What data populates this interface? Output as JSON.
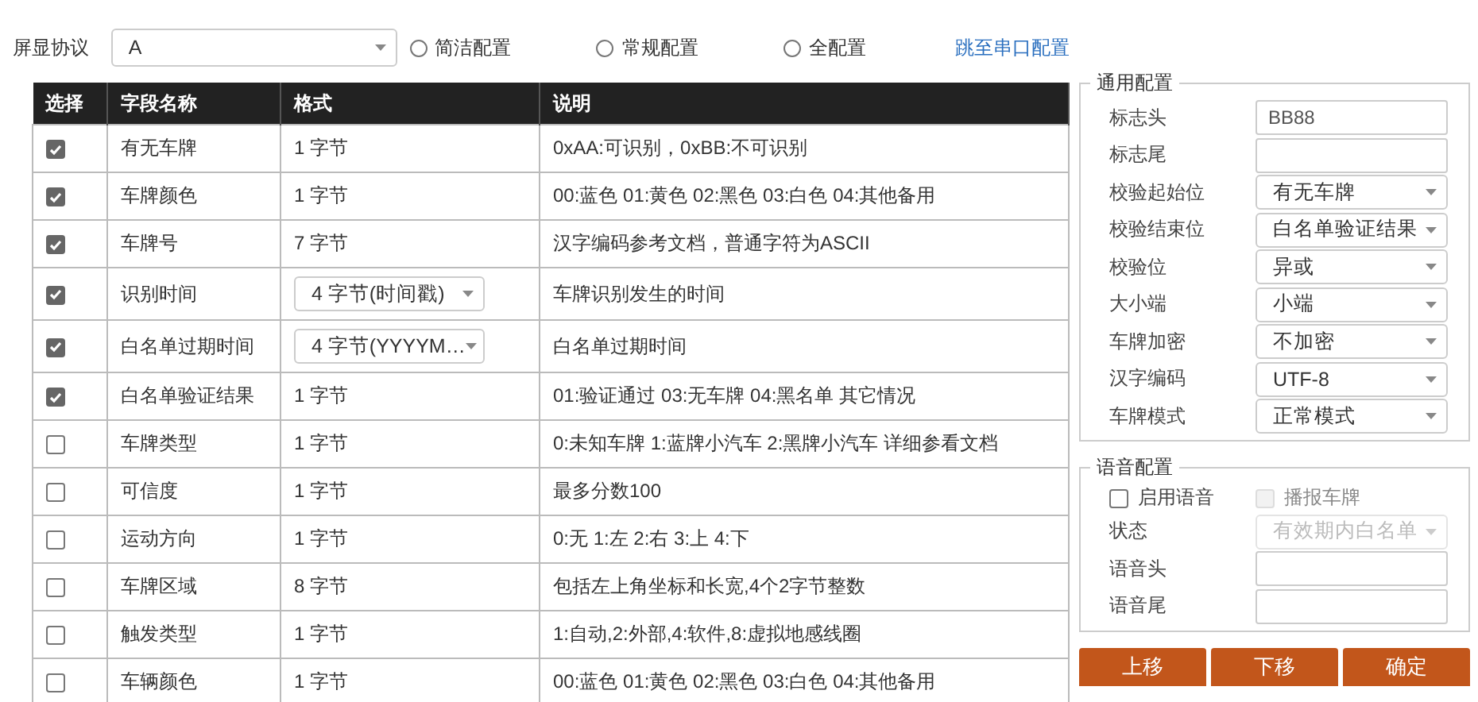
{
  "toolbar": {
    "protocol_label": "屏显协议",
    "protocol_value": "A",
    "radios": [
      {
        "label": "简洁配置",
        "selected": false
      },
      {
        "label": "常规配置",
        "selected": false
      },
      {
        "label": "全配置",
        "selected": false
      }
    ],
    "link": "跳至串口配置"
  },
  "table": {
    "columns": [
      "选择",
      "字段名称",
      "格式",
      "说明"
    ],
    "rows": [
      {
        "checked": true,
        "name": "有无车牌",
        "format": {
          "kind": "text",
          "value": "1 字节"
        },
        "description": "0xAA:可识别，0xBB:不可识别"
      },
      {
        "checked": true,
        "name": "车牌颜色",
        "format": {
          "kind": "text",
          "value": "1 字节"
        },
        "description": "00:蓝色 01:黄色 02:黑色 03:白色 04:其他备用"
      },
      {
        "checked": true,
        "name": "车牌号",
        "format": {
          "kind": "text",
          "value": "7 字节"
        },
        "description": "汉字编码参考文档，普通字符为ASCII"
      },
      {
        "checked": true,
        "name": "识别时间",
        "format": {
          "kind": "select",
          "value": "4 字节(时间戳)"
        },
        "description": "车牌识别发生的时间"
      },
      {
        "checked": true,
        "name": "白名单过期时间",
        "format": {
          "kind": "select",
          "value": "4 字节(YYYYM…"
        },
        "description": "白名单过期时间"
      },
      {
        "checked": true,
        "name": "白名单验证结果",
        "format": {
          "kind": "text",
          "value": "1 字节"
        },
        "description": "01:验证通过 03:无车牌 04:黑名单 其它情况"
      },
      {
        "checked": false,
        "name": "车牌类型",
        "format": {
          "kind": "text",
          "value": "1 字节"
        },
        "description": "0:未知车牌 1:蓝牌小汽车 2:黑牌小汽车 详细参看文档"
      },
      {
        "checked": false,
        "name": "可信度",
        "format": {
          "kind": "text",
          "value": "1 字节"
        },
        "description": "最多分数100"
      },
      {
        "checked": false,
        "name": "运动方向",
        "format": {
          "kind": "text",
          "value": "1 字节"
        },
        "description": "0:无 1:左 2:右 3:上 4:下"
      },
      {
        "checked": false,
        "name": "车牌区域",
        "format": {
          "kind": "text",
          "value": "8 字节"
        },
        "description": "包括左上角坐标和长宽,4个2字节整数"
      },
      {
        "checked": false,
        "name": "触发类型",
        "format": {
          "kind": "text",
          "value": "1 字节"
        },
        "description": "1:自动,2:外部,4:软件,8:虚拟地感线圈"
      },
      {
        "checked": false,
        "name": "车辆颜色",
        "format": {
          "kind": "text",
          "value": "1 字节"
        },
        "description": "00:蓝色 01:黄色 02:黑色 03:白色 04:其他备用"
      }
    ]
  },
  "general_config": {
    "title": "通用配置",
    "fields": [
      {
        "label": "标志头",
        "kind": "input",
        "value": "BB88"
      },
      {
        "label": "标志尾",
        "kind": "input"
      },
      {
        "label": "校验起始位",
        "kind": "select",
        "value": "有无车牌"
      },
      {
        "label": "校验结束位",
        "kind": "select",
        "value": "白名单验证结果"
      },
      {
        "label": "校验位",
        "kind": "select",
        "value": "异或"
      },
      {
        "label": "大小端",
        "kind": "select",
        "value": "小端"
      },
      {
        "label": "车牌加密",
        "kind": "select",
        "value": "不加密"
      },
      {
        "label": "汉字编码",
        "kind": "select",
        "value": "UTF-8"
      },
      {
        "label": "车牌模式",
        "kind": "select",
        "value": "正常模式"
      }
    ]
  },
  "voice_config": {
    "title": "语音配置",
    "checkboxes": [
      {
        "label": "启用语音",
        "checked": false,
        "disabled": false
      },
      {
        "label": "播报车牌",
        "checked": false,
        "disabled": true
      }
    ],
    "fields": [
      {
        "label": "状态",
        "kind": "select",
        "value": "有效期内白名单",
        "disabled": true
      },
      {
        "label": "语音头",
        "kind": "input"
      },
      {
        "label": "语音尾",
        "kind": "input"
      }
    ]
  },
  "buttons": [
    "上移",
    "下移",
    "确定"
  ]
}
